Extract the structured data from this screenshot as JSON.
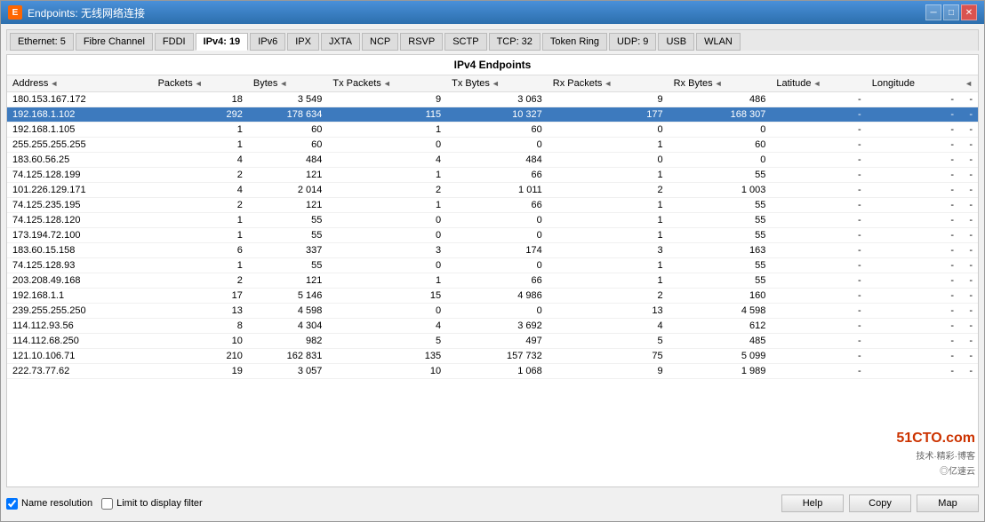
{
  "window": {
    "title": "Endpoints: 无线网络连接",
    "icon": "E"
  },
  "tabs": [
    {
      "label": "Ethernet: 5",
      "active": false
    },
    {
      "label": "Fibre Channel",
      "active": false
    },
    {
      "label": "FDDI",
      "active": false
    },
    {
      "label": "IPv4: 19",
      "active": true
    },
    {
      "label": "IPv6",
      "active": false
    },
    {
      "label": "IPX",
      "active": false
    },
    {
      "label": "JXTA",
      "active": false
    },
    {
      "label": "NCP",
      "active": false
    },
    {
      "label": "RSVP",
      "active": false
    },
    {
      "label": "SCTP",
      "active": false
    },
    {
      "label": "TCP: 32",
      "active": false
    },
    {
      "label": "Token Ring",
      "active": false
    },
    {
      "label": "UDP: 9",
      "active": false
    },
    {
      "label": "USB",
      "active": false
    },
    {
      "label": "WLAN",
      "active": false
    }
  ],
  "table": {
    "title": "IPv4 Endpoints",
    "columns": [
      "Address",
      "Packets",
      "Bytes",
      "Tx Packets",
      "Tx Bytes",
      "Rx Packets",
      "Rx Bytes",
      "Latitude",
      "Longitude"
    ],
    "rows": [
      {
        "address": "180.153.167.172",
        "packets": "18",
        "bytes": "3 549",
        "tx_packets": "9",
        "tx_bytes": "3 063",
        "rx_packets": "9",
        "rx_bytes": "486",
        "lat": "-",
        "lon": "-",
        "selected": false
      },
      {
        "address": "192.168.1.102",
        "packets": "292",
        "bytes": "178 634",
        "tx_packets": "115",
        "tx_bytes": "10 327",
        "rx_packets": "177",
        "rx_bytes": "168 307",
        "lat": "-",
        "lon": "-",
        "selected": true
      },
      {
        "address": "192.168.1.105",
        "packets": "1",
        "bytes": "60",
        "tx_packets": "1",
        "tx_bytes": "60",
        "rx_packets": "0",
        "rx_bytes": "0",
        "lat": "-",
        "lon": "-",
        "selected": false
      },
      {
        "address": "255.255.255.255",
        "packets": "1",
        "bytes": "60",
        "tx_packets": "0",
        "tx_bytes": "0",
        "rx_packets": "1",
        "rx_bytes": "60",
        "lat": "-",
        "lon": "-",
        "selected": false
      },
      {
        "address": "183.60.56.25",
        "packets": "4",
        "bytes": "484",
        "tx_packets": "4",
        "tx_bytes": "484",
        "rx_packets": "0",
        "rx_bytes": "0",
        "lat": "-",
        "lon": "-",
        "selected": false
      },
      {
        "address": "74.125.128.199",
        "packets": "2",
        "bytes": "121",
        "tx_packets": "1",
        "tx_bytes": "66",
        "rx_packets": "1",
        "rx_bytes": "55",
        "lat": "-",
        "lon": "-",
        "selected": false
      },
      {
        "address": "101.226.129.171",
        "packets": "4",
        "bytes": "2 014",
        "tx_packets": "2",
        "tx_bytes": "1 011",
        "rx_packets": "2",
        "rx_bytes": "1 003",
        "lat": "-",
        "lon": "-",
        "selected": false
      },
      {
        "address": "74.125.235.195",
        "packets": "2",
        "bytes": "121",
        "tx_packets": "1",
        "tx_bytes": "66",
        "rx_packets": "1",
        "rx_bytes": "55",
        "lat": "-",
        "lon": "-",
        "selected": false
      },
      {
        "address": "74.125.128.120",
        "packets": "1",
        "bytes": "55",
        "tx_packets": "0",
        "tx_bytes": "0",
        "rx_packets": "1",
        "rx_bytes": "55",
        "lat": "-",
        "lon": "-",
        "selected": false
      },
      {
        "address": "173.194.72.100",
        "packets": "1",
        "bytes": "55",
        "tx_packets": "0",
        "tx_bytes": "0",
        "rx_packets": "1",
        "rx_bytes": "55",
        "lat": "-",
        "lon": "-",
        "selected": false
      },
      {
        "address": "183.60.15.158",
        "packets": "6",
        "bytes": "337",
        "tx_packets": "3",
        "tx_bytes": "174",
        "rx_packets": "3",
        "rx_bytes": "163",
        "lat": "-",
        "lon": "-",
        "selected": false
      },
      {
        "address": "74.125.128.93",
        "packets": "1",
        "bytes": "55",
        "tx_packets": "0",
        "tx_bytes": "0",
        "rx_packets": "1",
        "rx_bytes": "55",
        "lat": "-",
        "lon": "-",
        "selected": false
      },
      {
        "address": "203.208.49.168",
        "packets": "2",
        "bytes": "121",
        "tx_packets": "1",
        "tx_bytes": "66",
        "rx_packets": "1",
        "rx_bytes": "55",
        "lat": "-",
        "lon": "-",
        "selected": false
      },
      {
        "address": "192.168.1.1",
        "packets": "17",
        "bytes": "5 146",
        "tx_packets": "15",
        "tx_bytes": "4 986",
        "rx_packets": "2",
        "rx_bytes": "160",
        "lat": "-",
        "lon": "-",
        "selected": false
      },
      {
        "address": "239.255.255.250",
        "packets": "13",
        "bytes": "4 598",
        "tx_packets": "0",
        "tx_bytes": "0",
        "rx_packets": "13",
        "rx_bytes": "4 598",
        "lat": "-",
        "lon": "-",
        "selected": false
      },
      {
        "address": "114.112.93.56",
        "packets": "8",
        "bytes": "4 304",
        "tx_packets": "4",
        "tx_bytes": "3 692",
        "rx_packets": "4",
        "rx_bytes": "612",
        "lat": "-",
        "lon": "-",
        "selected": false
      },
      {
        "address": "114.112.68.250",
        "packets": "10",
        "bytes": "982",
        "tx_packets": "5",
        "tx_bytes": "497",
        "rx_packets": "5",
        "rx_bytes": "485",
        "lat": "-",
        "lon": "-",
        "selected": false
      },
      {
        "address": "121.10.106.71",
        "packets": "210",
        "bytes": "162 831",
        "tx_packets": "135",
        "tx_bytes": "157 732",
        "rx_packets": "75",
        "rx_bytes": "5 099",
        "lat": "-",
        "lon": "-",
        "selected": false
      },
      {
        "address": "222.73.77.62",
        "packets": "19",
        "bytes": "3 057",
        "tx_packets": "10",
        "tx_bytes": "1 068",
        "rx_packets": "9",
        "rx_bytes": "1 989",
        "lat": "-",
        "lon": "-",
        "selected": false
      }
    ]
  },
  "bottom": {
    "name_resolution_label": "Name resolution",
    "limit_filter_label": "Limit to display filter",
    "help_btn": "Help",
    "copy_btn": "Copy",
    "map_btn": "Map"
  },
  "watermark": {
    "logo": "51CTO.com",
    "line1": "技术·精彩·博客",
    "line2": "◎亿速云"
  }
}
